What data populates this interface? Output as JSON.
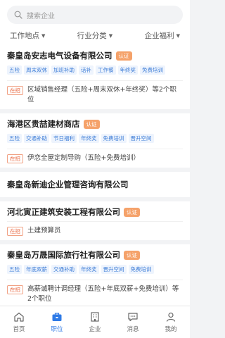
{
  "search": {
    "placeholder": "搜索企业"
  },
  "filters": [
    "工作地点",
    "行业分类",
    "企业福利"
  ],
  "companies": [
    {
      "name": "秦皇岛安志电气设备有限公司",
      "verified": "认证",
      "tags": [
        "五险",
        "周末双休",
        "加班补助",
        "话补",
        "工作餐",
        "年终奖",
        "免费培训"
      ],
      "job_badge": "在招",
      "job_text": "区域销售经理（五险+周末双休+年终奖）等2个职位"
    },
    {
      "name": "海港区贵喆建材商店",
      "verified": "认证",
      "tags": [
        "五险",
        "交通补助",
        "节日福利",
        "年终奖",
        "免费培训",
        "晋升空间"
      ],
      "job_badge": "在招",
      "job_text": "伊恋全屋定制导购（五险+免费培训）"
    },
    {
      "name": "秦皇岛新迪企业管理咨询有限公司"
    },
    {
      "name": "河北寅正建筑安装工程有限公司",
      "verified": "认证",
      "job_badge": "在招",
      "job_text": "土建预算员"
    },
    {
      "name": "秦皇岛万晟国际旅行社有限公司",
      "verified": "认证",
      "tags": [
        "五险",
        "年底双薪",
        "交通补助",
        "年终奖",
        "晋升空间",
        "免费培训"
      ],
      "job_badge": "在招",
      "job_text": "高薪诚聘计调经理（五险+年底双薪+免费培训）等2个职位"
    }
  ],
  "tabbar": [
    {
      "label": "首页",
      "icon": "home-icon"
    },
    {
      "label": "职位",
      "icon": "briefcase-icon",
      "active": true
    },
    {
      "label": "企业",
      "icon": "building-icon"
    },
    {
      "label": "消息",
      "icon": "message-icon"
    },
    {
      "label": "我的",
      "icon": "user-icon"
    }
  ],
  "colors": {
    "accent": "#2e7ae6",
    "verify": "#f5a26a",
    "onjob": "#e8643c",
    "tag_text": "#3b7bd6"
  }
}
